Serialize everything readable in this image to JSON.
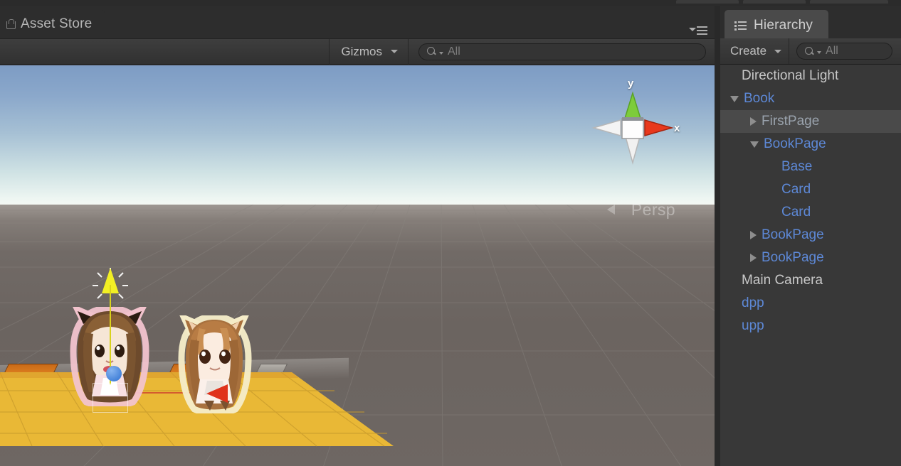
{
  "window": {
    "scene_tab": {
      "label": "Asset Store",
      "icon": "store-icon"
    },
    "panel_menu_icon": "panel-options-icon"
  },
  "scene_toolbar": {
    "gizmos_label": "Gizmos",
    "gizmos_caret_icon": "chevron-down-icon",
    "search": {
      "value": "All",
      "placeholder": "All",
      "icon": "search-icon"
    }
  },
  "scene_view": {
    "orientation_gizmo": {
      "y_axis_label": "y",
      "x_axis_label": "x",
      "y_axis_color": "#6ec02e",
      "x_axis_color": "#e8381c",
      "neg_axis_color": "#f2f2f2",
      "center_color": "#ffffff"
    },
    "projection_label": "Persp",
    "sky_top_color": "#7d9cc4",
    "horizon_color": "#eef6f2",
    "ground_color": "#6d6763",
    "platform_color": "#e8b637",
    "grid_color": "#8a8580",
    "light_gizmo_color": "#f2ef24",
    "x_handle_color": "#e0321c",
    "move_handle_color": "#2b6fd0"
  },
  "hierarchy": {
    "tab": {
      "label": "Hierarchy",
      "icon": "hierarchy-list-icon"
    },
    "create": {
      "label": "Create",
      "caret_icon": "chevron-down-icon"
    },
    "search": {
      "value": "All",
      "placeholder": "All",
      "icon": "search-icon"
    },
    "items": [
      {
        "label": "Directional Light",
        "indent": 0,
        "toggle": "none",
        "color": "white",
        "selected": false
      },
      {
        "label": "Book",
        "indent": 0,
        "toggle": "open",
        "color": "blue",
        "selected": false
      },
      {
        "label": "FirstPage",
        "indent": 1,
        "toggle": "closed",
        "color": "selected",
        "selected": true
      },
      {
        "label": "BookPage",
        "indent": 1,
        "toggle": "open",
        "color": "blue",
        "selected": false
      },
      {
        "label": "Base",
        "indent": 2,
        "toggle": "none",
        "color": "blue",
        "selected": false
      },
      {
        "label": "Card",
        "indent": 2,
        "toggle": "none",
        "color": "blue",
        "selected": false
      },
      {
        "label": "Card",
        "indent": 2,
        "toggle": "none",
        "color": "blue",
        "selected": false
      },
      {
        "label": "BookPage",
        "indent": 1,
        "toggle": "closed",
        "color": "blue",
        "selected": false
      },
      {
        "label": "BookPage",
        "indent": 1,
        "toggle": "closed",
        "color": "blue",
        "selected": false
      },
      {
        "label": "Main Camera",
        "indent": 0,
        "toggle": "none",
        "color": "white",
        "selected": false
      },
      {
        "label": "dpp",
        "indent": 0,
        "toggle": "none",
        "color": "blue",
        "selected": false
      },
      {
        "label": "upp",
        "indent": 0,
        "toggle": "none",
        "color": "blue",
        "selected": false
      }
    ]
  }
}
